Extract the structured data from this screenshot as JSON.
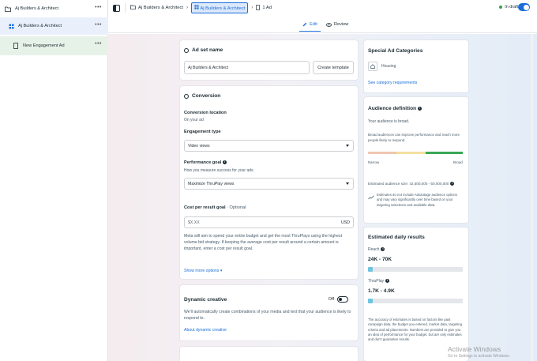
{
  "nav": {
    "items": [
      {
        "label": "Aj Builders & Architect",
        "icon": "folder-icon"
      },
      {
        "label": "Aj Builders & Architect",
        "icon": "grid-icon"
      },
      {
        "label": "New Engagement Ad",
        "icon": "document-icon"
      }
    ],
    "more": "•••"
  },
  "topbar": {
    "crumb1": "Aj Builders & Architect",
    "crumb2": "Aj Builders & Architect",
    "crumb3": "1 Ad",
    "status": "In draft"
  },
  "modes": {
    "edit": "Edit",
    "review": "Review"
  },
  "adset": {
    "section_title": "Ad set name",
    "name_value": "Aj Builders & Architect",
    "create_template": "Create template"
  },
  "conversion": {
    "title": "Conversion",
    "location_label": "Conversion location",
    "location_value": "On your ad",
    "engagement_label": "Engagement type",
    "engagement_value": "Video views",
    "perf_label": "Performance goal",
    "perf_sub": "How you measure success for your ads.",
    "perf_value": "Maximize ThruPlay views",
    "cost_label": "Cost per result goal",
    "cost_optional": "· Optional",
    "cost_placeholder": "$X.XX",
    "currency": "USD",
    "description": "Meta will aim to spend your entire budget and get the most ThruPlays using the highest volume bid strategy. If keeping the average cost per result around a certain amount is important, enter a cost per result goal.",
    "show_more": "Show more options ▾"
  },
  "dynamic": {
    "title": "Dynamic creative",
    "state": "Off",
    "description": "We'll automatically create combinations of your media and text that your audience is likely to respond to.",
    "link": "About dynamic creative"
  },
  "special": {
    "title": "Special Ad Categories",
    "housing": "Housing",
    "link": "See category requirements"
  },
  "audience": {
    "title": "Audience definition",
    "status": "Your audience is broad.",
    "note": "Broad audiences can improve performance and reach more people likely to respond.",
    "narrow": "Narrow",
    "broad": "Broad",
    "estimated": "Estimated audience size: 42,500,000 - 50,000,000",
    "disclaimer": "Estimates do not include Advantage audience options and may vary significantly over time based on your targeting selections and available data."
  },
  "daily": {
    "title": "Estimated daily results",
    "reach_label": "Reach",
    "reach_value": "24K - 70K",
    "reach_level": 0.05,
    "thruplay_label": "ThruPlay",
    "thruplay_value": "1.7K - 4.9K",
    "thruplay_level": 0.05,
    "disclaimer": "The accuracy of estimates is based on factors like past campaign data, the budget you entered, market data, targeting criteria and ad placements. Numbers are provided to give you an idea of performance for your budget, but are only estimates and don't guarantee results."
  },
  "watermark": {
    "title": "Activate Windows",
    "sub": "Go to Settings to activate Windows."
  },
  "colors": {
    "accent": "#1a6ed8",
    "success": "#31a24c",
    "bar_fill": "#6fc4e0"
  }
}
